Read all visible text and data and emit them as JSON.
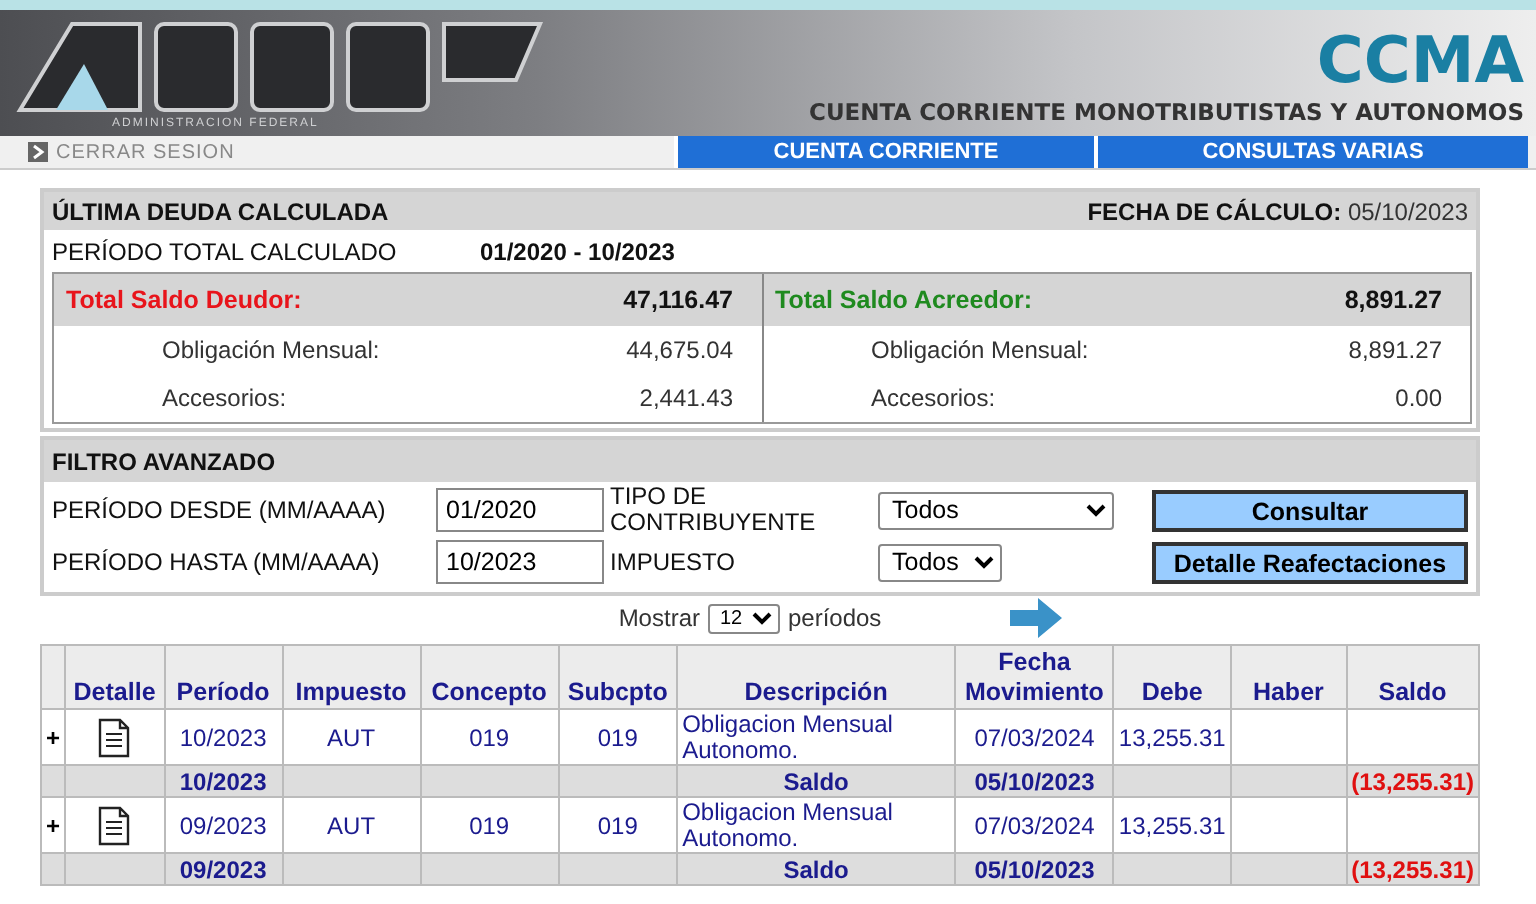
{
  "header": {
    "logo_subtitle": "ADMINISTRACION FEDERAL",
    "app_name": "CCMA",
    "app_subtitle": "CUENTA CORRIENTE MONOTRIBUTISTAS Y AUTONOMOS",
    "logout": "CERRAR SESION",
    "nav": [
      {
        "label": "CUENTA CORRIENTE"
      },
      {
        "label": "CONSULTAS VARIAS"
      }
    ]
  },
  "summary": {
    "title": "ÚLTIMA DEUDA CALCULADA",
    "date_label": "FECHA DE CÁLCULO:",
    "date_value": "05/10/2023",
    "period_label": "PERÍODO TOTAL CALCULADO",
    "period_value": "01/2020 - 10/2023",
    "panels": [
      {
        "label": "Total Saldo Deudor:",
        "color": "#e8141b",
        "total": "47,116.47",
        "rows": [
          {
            "label": "Obligación Mensual:",
            "value": "44,675.04"
          },
          {
            "label": "Accesorios:",
            "value": "2,441.43"
          }
        ]
      },
      {
        "label": "Total Saldo Acreedor:",
        "color": "#1f8a1f",
        "total": "8,891.27",
        "rows": [
          {
            "label": "Obligación Mensual:",
            "value": "8,891.27"
          },
          {
            "label": "Accesorios:",
            "value": "0.00"
          }
        ]
      }
    ]
  },
  "filter": {
    "title": "FILTRO AVANZADO",
    "rows": [
      {
        "label": "PERÍODO DESDE (MM/AAAA)",
        "value": "01/2020",
        "select_label": "TIPO DE CONTRIBUYENTE",
        "select_value": "Todos",
        "wide": true,
        "button": "Consultar"
      },
      {
        "label": "PERÍODO HASTA (MM/AAAA)",
        "value": "10/2023",
        "select_label": "IMPUESTO",
        "select_value": "Todos",
        "wide": false,
        "button": "Detalle Reafectaciones"
      }
    ]
  },
  "pager": {
    "before": "Mostrar",
    "value": "12",
    "after": "períodos"
  },
  "table": {
    "columns": [
      "",
      "Detalle",
      "Período",
      "Impuesto",
      "Concepto",
      "Subcpto",
      "Descripción",
      "Fecha Movimiento",
      "Debe",
      "Haber",
      "Saldo"
    ],
    "rows": [
      {
        "kind": "movement",
        "expand": "+",
        "period": "10/2023",
        "tax": "AUT",
        "concept": "019",
        "subconcept": "019",
        "description": "Obligacion Mensual Autonomo.",
        "date": "07/03/2024",
        "debit": "13,255.31"
      },
      {
        "kind": "saldo",
        "period": "10/2023",
        "description": "Saldo",
        "date": "05/10/2023",
        "balance": "(13,255.31)"
      },
      {
        "kind": "movement",
        "expand": "+",
        "period": "09/2023",
        "tax": "AUT",
        "concept": "019",
        "subconcept": "019",
        "description": "Obligacion Mensual Autonomo.",
        "date": "07/03/2024",
        "debit": "13,255.31"
      },
      {
        "kind": "saldo",
        "period": "09/2023",
        "description": "Saldo",
        "date": "05/10/2023",
        "balance": "(13,255.31)"
      }
    ]
  }
}
